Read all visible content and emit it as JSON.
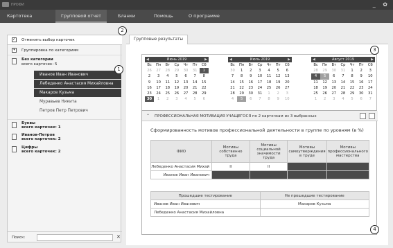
{
  "titlebar": {
    "title": "ПРОФИ",
    "controls": "_ ✿"
  },
  "menu": {
    "items": [
      {
        "label": "Картотека"
      },
      {
        "label": "Групповой отчет"
      },
      {
        "label": "Бланки"
      },
      {
        "label": "Помощь"
      },
      {
        "label": "О программе"
      }
    ]
  },
  "left": {
    "deselect_label": "Отменить выбор карточек",
    "group_label": "Группировка по категориям",
    "no_category": {
      "title": "Без категории",
      "count": "всего карточек: 5"
    },
    "people": [
      {
        "name": "Иванов Иван Иванович"
      },
      {
        "name": "Лебеденко Анастасия Михайловна"
      },
      {
        "name": "Макаров Кузьма"
      },
      {
        "name": "Муравьев Никита"
      },
      {
        "name": "Петров Петр Петрович"
      }
    ],
    "groups": [
      {
        "title": "Буквы",
        "count": "всего карточек: 1"
      },
      {
        "title": "Иванов-Петров",
        "count": "всего карточек: 2"
      },
      {
        "title": "Цифры",
        "count": "всего карточек: 2"
      }
    ],
    "search_label": "Поиск:",
    "search_value": "",
    "clear": "✕"
  },
  "badges": {
    "b1": "1",
    "b2": "2",
    "b3": "3",
    "b4": "4"
  },
  "tab": {
    "label": "Групповые результаты"
  },
  "calendars": [
    {
      "title": "Июнь 2019",
      "weekdays": [
        "Вс",
        "Пн",
        "Вт",
        "Ср",
        "Чт",
        "Пт",
        "Сб"
      ],
      "weeks": [
        [
          "26",
          "27",
          "28",
          "29",
          "30",
          "31",
          "1"
        ],
        [
          "2",
          "3",
          "4",
          "5",
          "6",
          "7",
          "8"
        ],
        [
          "9",
          "10",
          "11",
          "12",
          "13",
          "14",
          "15"
        ],
        [
          "16",
          "17",
          "18",
          "19",
          "20",
          "21",
          "22"
        ],
        [
          "23",
          "24",
          "25",
          "26",
          "27",
          "28",
          "29"
        ],
        [
          "30",
          "1",
          "2",
          "3",
          "4",
          "5",
          "6"
        ]
      ]
    },
    {
      "title": "Июль 2019",
      "weekdays": [
        "Вс",
        "Пн",
        "Вт",
        "Ср",
        "Чт",
        "Пт",
        "Сб"
      ],
      "weeks": [
        [
          "30",
          "1",
          "2",
          "3",
          "4",
          "5",
          "6"
        ],
        [
          "7",
          "8",
          "9",
          "10",
          "11",
          "12",
          "13"
        ],
        [
          "14",
          "15",
          "16",
          "17",
          "18",
          "19",
          "20"
        ],
        [
          "21",
          "22",
          "23",
          "24",
          "25",
          "26",
          "27"
        ],
        [
          "28",
          "29",
          "30",
          "31",
          "1",
          "2",
          "3"
        ],
        [
          "4",
          "5",
          "6",
          "7",
          "8",
          "9",
          "10"
        ]
      ]
    },
    {
      "title": "Август 2019",
      "weekdays": [
        "Вс",
        "Пн",
        "Вт",
        "Ср",
        "Чт",
        "Пт",
        "Сб"
      ],
      "weeks": [
        [
          "28",
          "29",
          "30",
          "31",
          "1",
          "2",
          "3"
        ],
        [
          "4",
          "5",
          "6",
          "7",
          "8",
          "9",
          "10"
        ],
        [
          "11",
          "12",
          "13",
          "14",
          "15",
          "16",
          "17"
        ],
        [
          "18",
          "19",
          "20",
          "21",
          "22",
          "23",
          "24"
        ],
        [
          "25",
          "26",
          "27",
          "28",
          "29",
          "30",
          "31"
        ],
        [
          "1",
          "2",
          "3",
          "4",
          "5",
          "6",
          "7"
        ]
      ]
    }
  ],
  "card": {
    "title": "ПРОФЕССИОНАЛЬНАЯ МОТИВАЦИЯ УЧАЩЕГОСЯ по 2 карточкам из 3 выбранных",
    "subtitle": "Сформированность мотивов профессиональной деятельности в группе по уровням (в %)",
    "columns": [
      "ФИО",
      "Мотивы собственно труда",
      "Мотивы социальной значимости труда",
      "Мотивы самоутверждения в труде",
      "Мотивы профессионального мастерства"
    ],
    "rows": [
      {
        "name": "Лебеденко Анастасия Михай",
        "v1": "II",
        "v2": "II"
      },
      {
        "name": "Иванов Иван Иванович",
        "v1": "",
        "v2": ""
      }
    ],
    "passed_header": "Прошедшие тестирование",
    "not_passed_header": "Не прошедшие тестирование",
    "passed": [
      "Иванов Иван Иванович",
      "Лебеденко Анастасия Михайловна"
    ],
    "not_passed": [
      "Макаров Кузьма"
    ]
  }
}
